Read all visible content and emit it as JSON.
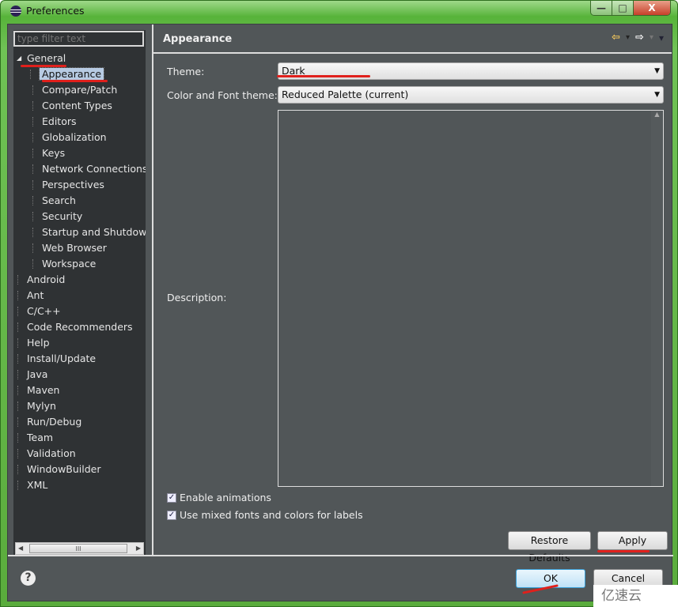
{
  "window": {
    "title": "Preferences",
    "minimize": "—",
    "maximize": "□",
    "close": "X"
  },
  "sidebar": {
    "filter_placeholder": "type filter text",
    "general": {
      "label": "General",
      "children": [
        "Appearance",
        "Compare/Patch",
        "Content Types",
        "Editors",
        "Globalization",
        "Keys",
        "Network Connections",
        "Perspectives",
        "Search",
        "Security",
        "Startup and Shutdown",
        "Web Browser",
        "Workspace"
      ],
      "selected": "Appearance"
    },
    "items": [
      "Android",
      "Ant",
      "C/C++",
      "Code Recommenders",
      "Help",
      "Install/Update",
      "Java",
      "Maven",
      "Mylyn",
      "Run/Debug",
      "Team",
      "Validation",
      "WindowBuilder",
      "XML"
    ],
    "scroll_thumb": "III"
  },
  "page": {
    "title": "Appearance",
    "nav": {
      "back": "⇦",
      "back_menu": "▾",
      "forward": "⇨",
      "forward_menu": "▾",
      "view_menu": "▾"
    },
    "theme_label": "Theme:",
    "theme_value": "Dark",
    "color_font_label": "Color and Font theme:",
    "color_font_value": "Reduced Palette (current)",
    "description_label": "Description:",
    "enable_animations": {
      "label": "Enable animations",
      "checked": true
    },
    "mixed_fonts": {
      "label": "Use mixed fonts and colors for labels",
      "checked": true
    },
    "restore_defaults": "Restore Defaults",
    "apply": "Apply"
  },
  "footer": {
    "help": "?",
    "ok": "OK",
    "cancel": "Cancel"
  },
  "watermark": "亿速云",
  "colors": {
    "annotation": "#e0201c",
    "panel": "#515658",
    "tree_bg": "#2f3234",
    "title_bar": "#57b33a"
  }
}
